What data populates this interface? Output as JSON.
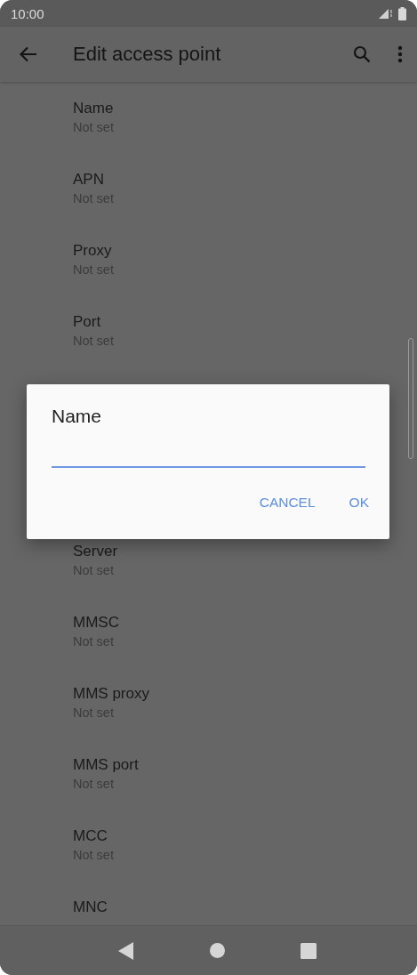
{
  "status_bar": {
    "time": "10:00"
  },
  "app_bar": {
    "title": "Edit access point"
  },
  "items_above": [
    {
      "title": "Name",
      "summary": "Not set"
    },
    {
      "title": "APN",
      "summary": "Not set"
    },
    {
      "title": "Proxy",
      "summary": "Not set"
    },
    {
      "title": "Port",
      "summary": "Not set"
    }
  ],
  "items_below": [
    {
      "title": "Server",
      "summary": "Not set"
    },
    {
      "title": "MMSC",
      "summary": "Not set"
    },
    {
      "title": "MMS proxy",
      "summary": "Not set"
    },
    {
      "title": "MMS port",
      "summary": "Not set"
    },
    {
      "title": "MCC",
      "summary": "Not set"
    },
    {
      "title": "MNC"
    }
  ],
  "dialog": {
    "title": "Name",
    "buttons": [
      "CANCEL",
      "OK"
    ]
  }
}
